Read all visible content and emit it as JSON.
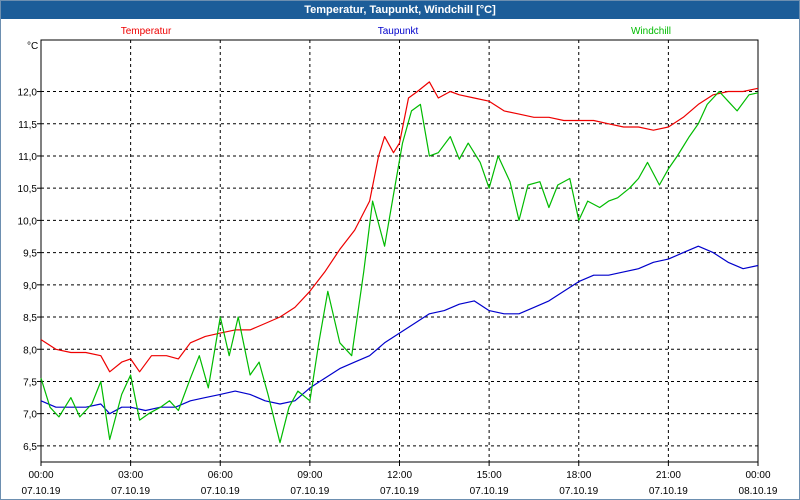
{
  "window": {
    "title": "Temperatur, Taupunkt, Windchill [°C]"
  },
  "colors": {
    "temperatur": "#ee0000",
    "taupunkt": "#0000cc",
    "windchill": "#00bb00",
    "grid": "#000000",
    "titlebar": "#1c5d99"
  },
  "chart_data": {
    "type": "line",
    "title": "Temperatur, Taupunkt, Windchill [°C]",
    "ylabel": "°C",
    "xlabel": "",
    "ylim": [
      6.25,
      12.8
    ],
    "xlim": [
      0,
      24
    ],
    "grid": true,
    "legend_position": "top",
    "y_ticks": [
      "6,5",
      "7,0",
      "7,5",
      "8,0",
      "8,5",
      "9,0",
      "9,5",
      "10,0",
      "10,5",
      "11,0",
      "11,5",
      "12,0"
    ],
    "y_tick_values": [
      6.5,
      7.0,
      7.5,
      8.0,
      8.5,
      9.0,
      9.5,
      10.0,
      10.5,
      11.0,
      11.5,
      12.0
    ],
    "x_ticks": [
      {
        "time": "00:00",
        "date": "07.10.19",
        "h": 0
      },
      {
        "time": "03:00",
        "date": "07.10.19",
        "h": 3
      },
      {
        "time": "06:00",
        "date": "07.10.19",
        "h": 6
      },
      {
        "time": "09:00",
        "date": "07.10.19",
        "h": 9
      },
      {
        "time": "12:00",
        "date": "07.10.19",
        "h": 12
      },
      {
        "time": "15:00",
        "date": "07.10.19",
        "h": 15
      },
      {
        "time": "18:00",
        "date": "07.10.19",
        "h": 18
      },
      {
        "time": "21:00",
        "date": "07.10.19",
        "h": 21
      },
      {
        "time": "00:00",
        "date": "08.10.19",
        "h": 24
      }
    ],
    "series": [
      {
        "name": "Temperatur",
        "color": "#ee0000",
        "points": [
          [
            0,
            8.15
          ],
          [
            0.5,
            8.0
          ],
          [
            1,
            7.95
          ],
          [
            1.5,
            7.95
          ],
          [
            2,
            7.9
          ],
          [
            2.3,
            7.65
          ],
          [
            2.7,
            7.8
          ],
          [
            3,
            7.85
          ],
          [
            3.3,
            7.65
          ],
          [
            3.7,
            7.9
          ],
          [
            4.2,
            7.9
          ],
          [
            4.6,
            7.85
          ],
          [
            5,
            8.1
          ],
          [
            5.5,
            8.2
          ],
          [
            6,
            8.25
          ],
          [
            6.5,
            8.3
          ],
          [
            7,
            8.3
          ],
          [
            7.5,
            8.4
          ],
          [
            8,
            8.5
          ],
          [
            8.5,
            8.65
          ],
          [
            9,
            8.9
          ],
          [
            9.5,
            9.2
          ],
          [
            10,
            9.55
          ],
          [
            10.5,
            9.85
          ],
          [
            11,
            10.3
          ],
          [
            11.3,
            11.0
          ],
          [
            11.5,
            11.3
          ],
          [
            11.8,
            11.05
          ],
          [
            12,
            11.2
          ],
          [
            12.3,
            11.9
          ],
          [
            12.6,
            12.0
          ],
          [
            13,
            12.15
          ],
          [
            13.3,
            11.9
          ],
          [
            13.7,
            12.0
          ],
          [
            14,
            11.95
          ],
          [
            14.5,
            11.9
          ],
          [
            15,
            11.85
          ],
          [
            15.5,
            11.7
          ],
          [
            16,
            11.65
          ],
          [
            16.5,
            11.6
          ],
          [
            17,
            11.6
          ],
          [
            17.5,
            11.55
          ],
          [
            18,
            11.55
          ],
          [
            18.5,
            11.55
          ],
          [
            19,
            11.5
          ],
          [
            19.5,
            11.45
          ],
          [
            20,
            11.45
          ],
          [
            20.5,
            11.4
          ],
          [
            21,
            11.45
          ],
          [
            21.5,
            11.6
          ],
          [
            22,
            11.8
          ],
          [
            22.5,
            11.95
          ],
          [
            23,
            12.0
          ],
          [
            23.5,
            12.0
          ],
          [
            24,
            12.05
          ]
        ]
      },
      {
        "name": "Taupunkt",
        "color": "#0000cc",
        "points": [
          [
            0,
            7.2
          ],
          [
            0.5,
            7.1
          ],
          [
            1,
            7.1
          ],
          [
            1.5,
            7.1
          ],
          [
            2,
            7.15
          ],
          [
            2.3,
            7.0
          ],
          [
            2.7,
            7.1
          ],
          [
            3,
            7.1
          ],
          [
            3.5,
            7.05
          ],
          [
            4,
            7.1
          ],
          [
            4.5,
            7.1
          ],
          [
            5,
            7.2
          ],
          [
            5.5,
            7.25
          ],
          [
            6,
            7.3
          ],
          [
            6.5,
            7.35
          ],
          [
            7,
            7.3
          ],
          [
            7.5,
            7.2
          ],
          [
            8,
            7.15
          ],
          [
            8.5,
            7.2
          ],
          [
            9,
            7.4
          ],
          [
            9.5,
            7.55
          ],
          [
            10,
            7.7
          ],
          [
            10.5,
            7.8
          ],
          [
            11,
            7.9
          ],
          [
            11.5,
            8.1
          ],
          [
            12,
            8.25
          ],
          [
            12.5,
            8.4
          ],
          [
            13,
            8.55
          ],
          [
            13.5,
            8.6
          ],
          [
            14,
            8.7
          ],
          [
            14.5,
            8.75
          ],
          [
            15,
            8.6
          ],
          [
            15.5,
            8.55
          ],
          [
            16,
            8.55
          ],
          [
            16.5,
            8.65
          ],
          [
            17,
            8.75
          ],
          [
            17.5,
            8.9
          ],
          [
            18,
            9.05
          ],
          [
            18.5,
            9.15
          ],
          [
            19,
            9.15
          ],
          [
            19.5,
            9.2
          ],
          [
            20,
            9.25
          ],
          [
            20.5,
            9.35
          ],
          [
            21,
            9.4
          ],
          [
            21.5,
            9.5
          ],
          [
            22,
            9.6
          ],
          [
            22.5,
            9.5
          ],
          [
            23,
            9.35
          ],
          [
            23.5,
            9.25
          ],
          [
            24,
            9.3
          ]
        ]
      },
      {
        "name": "Windchill",
        "color": "#00bb00",
        "points": [
          [
            0,
            7.55
          ],
          [
            0.3,
            7.1
          ],
          [
            0.6,
            6.95
          ],
          [
            1,
            7.25
          ],
          [
            1.3,
            6.95
          ],
          [
            1.7,
            7.15
          ],
          [
            2,
            7.5
          ],
          [
            2.3,
            6.6
          ],
          [
            2.7,
            7.3
          ],
          [
            3,
            7.6
          ],
          [
            3.3,
            6.9
          ],
          [
            3.6,
            7.0
          ],
          [
            4,
            7.1
          ],
          [
            4.3,
            7.2
          ],
          [
            4.6,
            7.05
          ],
          [
            5,
            7.55
          ],
          [
            5.3,
            7.9
          ],
          [
            5.6,
            7.4
          ],
          [
            6,
            8.5
          ],
          [
            6.3,
            7.9
          ],
          [
            6.6,
            8.5
          ],
          [
            7,
            7.6
          ],
          [
            7.3,
            7.8
          ],
          [
            7.6,
            7.3
          ],
          [
            8,
            6.55
          ],
          [
            8.3,
            7.1
          ],
          [
            8.6,
            7.35
          ],
          [
            9,
            7.2
          ],
          [
            9.3,
            8.1
          ],
          [
            9.6,
            8.9
          ],
          [
            10,
            8.1
          ],
          [
            10.4,
            7.9
          ],
          [
            10.8,
            9.2
          ],
          [
            11.1,
            10.3
          ],
          [
            11.5,
            9.6
          ],
          [
            11.8,
            10.4
          ],
          [
            12.1,
            11.2
          ],
          [
            12.4,
            11.7
          ],
          [
            12.7,
            11.8
          ],
          [
            13,
            11.0
          ],
          [
            13.3,
            11.05
          ],
          [
            13.7,
            11.3
          ],
          [
            14,
            10.95
          ],
          [
            14.3,
            11.2
          ],
          [
            14.7,
            10.9
          ],
          [
            15,
            10.5
          ],
          [
            15.3,
            11.0
          ],
          [
            15.7,
            10.6
          ],
          [
            16,
            10.0
          ],
          [
            16.3,
            10.55
          ],
          [
            16.7,
            10.6
          ],
          [
            17,
            10.2
          ],
          [
            17.3,
            10.55
          ],
          [
            17.7,
            10.65
          ],
          [
            18,
            10.0
          ],
          [
            18.3,
            10.3
          ],
          [
            18.7,
            10.2
          ],
          [
            19,
            10.3
          ],
          [
            19.3,
            10.35
          ],
          [
            19.7,
            10.5
          ],
          [
            20,
            10.65
          ],
          [
            20.3,
            10.9
          ],
          [
            20.7,
            10.55
          ],
          [
            21,
            10.8
          ],
          [
            21.3,
            11.0
          ],
          [
            21.7,
            11.3
          ],
          [
            22,
            11.5
          ],
          [
            22.3,
            11.8
          ],
          [
            22.7,
            12.0
          ],
          [
            23,
            11.85
          ],
          [
            23.3,
            11.7
          ],
          [
            23.7,
            11.95
          ],
          [
            24,
            11.98
          ]
        ]
      }
    ]
  }
}
